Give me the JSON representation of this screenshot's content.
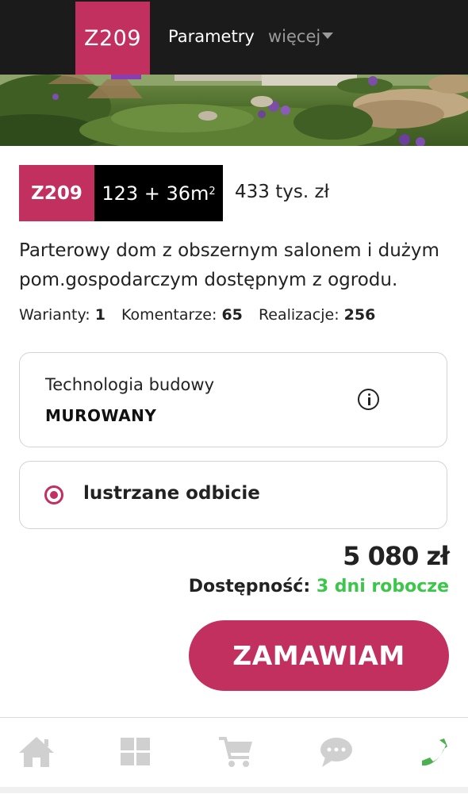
{
  "header": {
    "logo_label": "Z209",
    "nav": {
      "params_label": "Parametry",
      "more_label": "więcej"
    }
  },
  "product": {
    "code": "Z209",
    "area": "123 + 36m",
    "area_superscript": "2",
    "price_short": "433 tys. zł",
    "description": "Parterowy dom z obszernym salonem i dużym pom.gospodarczym dostępnym z ogrodu.",
    "stats": {
      "variants_label": "Warianty:",
      "variants_value": "1",
      "comments_label": "Komentarze:",
      "comments_value": "65",
      "realizations_label": "Realizacje:",
      "realizations_value": "256"
    }
  },
  "technology": {
    "label": "Technologia budowy",
    "value": "MUROWANY",
    "icon": "info-icon"
  },
  "mirror_option": {
    "label": "lustrzane odbicie",
    "selected": true
  },
  "pricing": {
    "total": "5 080 zł",
    "availability_label": "Dostępność:",
    "availability_value": "3 dni robocze"
  },
  "order_button": {
    "label": "ZAMAWIAM"
  },
  "bottom_nav": {
    "items": [
      {
        "icon": "home-icon"
      },
      {
        "icon": "grid-icon"
      },
      {
        "icon": "cart-icon"
      },
      {
        "icon": "chat-icon"
      },
      {
        "icon": "phone-icon"
      }
    ]
  },
  "colors": {
    "brand": "#c1305f",
    "header_bg": "#1b1b1b",
    "availability_green": "#3cc64a",
    "nav_icon_gray": "#d0d0d0",
    "phone_green": "#4caf50"
  }
}
